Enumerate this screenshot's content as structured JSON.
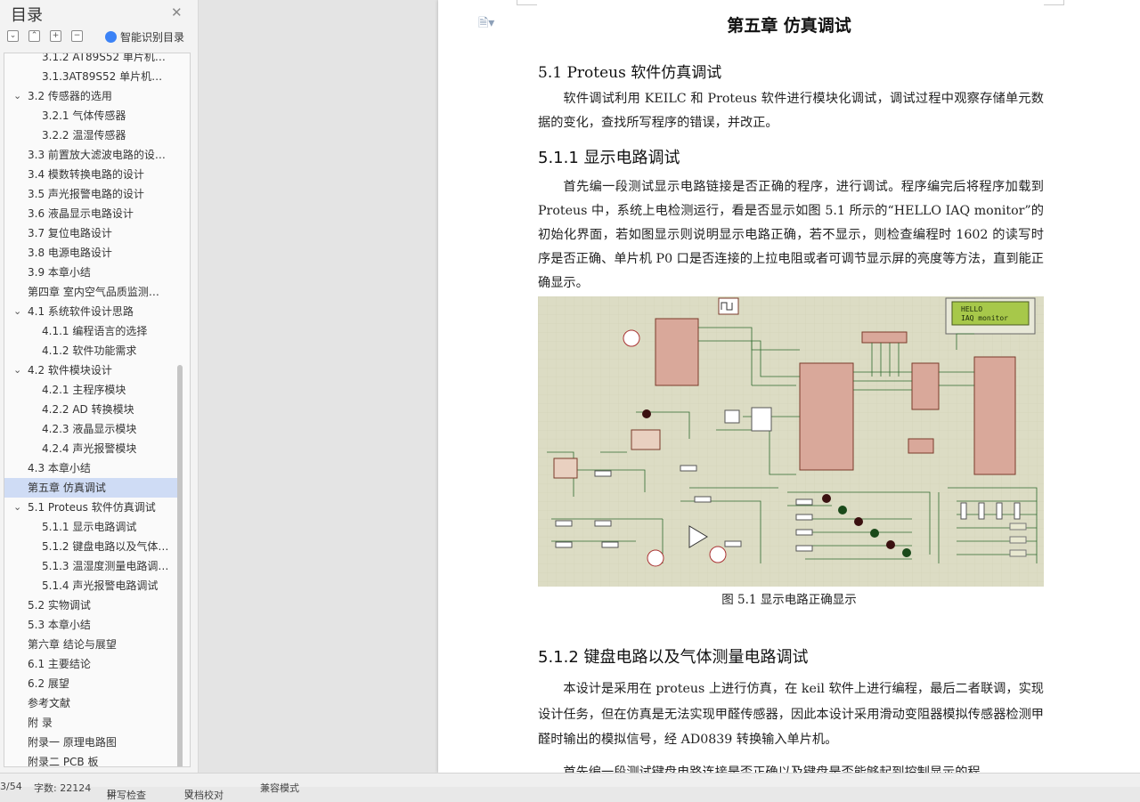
{
  "sidebar": {
    "title": "目录",
    "smart_toc_label": "智能识别目录",
    "items": [
      {
        "label": "3.1.2 AT89S52 单片机…",
        "level": 3
      },
      {
        "label": "3.1.3AT89S52 单片机…",
        "level": 3
      },
      {
        "label": "3.2 传感器的选用",
        "level": 2,
        "expanded": true
      },
      {
        "label": "3.2.1 气体传感器",
        "level": 3
      },
      {
        "label": "3.2.2 温湿传感器",
        "level": 3
      },
      {
        "label": "3.3 前置放大滤波电路的设…",
        "level": 2
      },
      {
        "label": "3.4 模数转换电路的设计",
        "level": 2
      },
      {
        "label": "3.5 声光报警电路的设计",
        "level": 2
      },
      {
        "label": "3.6 液晶显示电路设计",
        "level": 2
      },
      {
        "label": "3.7 复位电路设计",
        "level": 2
      },
      {
        "label": "3.8 电源电路设计",
        "level": 2
      },
      {
        "label": "3.9 本章小结",
        "level": 2
      },
      {
        "label": "第四章  室内空气品质监测…",
        "level": 1
      },
      {
        "label": "4.1 系统软件设计思路",
        "level": 2,
        "expanded": true
      },
      {
        "label": "4.1.1 编程语言的选择",
        "level": 3
      },
      {
        "label": "4.1.2 软件功能需求",
        "level": 3
      },
      {
        "label": "4.2 软件模块设计",
        "level": 2,
        "expanded": true
      },
      {
        "label": "4.2.1 主程序模块",
        "level": 3
      },
      {
        "label": "4.2.2 AD 转换模块",
        "level": 3
      },
      {
        "label": "4.2.3 液晶显示模块",
        "level": 3
      },
      {
        "label": "4.2.4 声光报警模块",
        "level": 3
      },
      {
        "label": "4.3 本章小结",
        "level": 2
      },
      {
        "label": "第五章  仿真调试",
        "level": 1,
        "selected": true
      },
      {
        "label": "5.1 Proteus  软件仿真调试",
        "level": 2,
        "expanded": true
      },
      {
        "label": "5.1.1 显示电路调试",
        "level": 3
      },
      {
        "label": "5.1.2 键盘电路以及气体…",
        "level": 3
      },
      {
        "label": "5.1.3 温湿度测量电路调…",
        "level": 3
      },
      {
        "label": "5.1.4 声光报警电路调试",
        "level": 3
      },
      {
        "label": "5.2  实物调试",
        "level": 2
      },
      {
        "label": "5.3 本章小结",
        "level": 2
      },
      {
        "label": "第六章    结论与展望",
        "level": 1
      },
      {
        "label": "6.1 主要结论",
        "level": 2
      },
      {
        "label": "6.2 展望",
        "level": 2
      },
      {
        "label": "参考文献",
        "level": 1
      },
      {
        "label": "附    录",
        "level": 1
      },
      {
        "label": "附录一  原理电路图",
        "level": 1
      },
      {
        "label": "附录二  PCB 板",
        "level": 1
      }
    ]
  },
  "document": {
    "chapter_title": "第五章  仿真调试",
    "section_5_1": "5.1 Proteus  软件仿真调试",
    "para_1": "软件调试利用 KEILC 和 Proteus 软件进行模块化调试，调试过程中观察存储单元数据的变化，查找所写程序的错误，并改正。",
    "section_5_1_1": "5.1.1 显示电路调试",
    "para_2": "首先编一段测试显示电路链接是否正确的程序，进行调试。程序编完后将程序加载到 Proteus 中，系统上电检测运行，看是否显示如图 5.1 所示的“HELLO IAQ monitor”的初始化界面，若如图显示则说明显示电路正确，若不显示，则检查编程时 1602 的读写时序是否正确、单片机 P0 口是否连接的上拉电阻或者可调节显示屏的亮度等方法，直到能正确显示。",
    "figure": {
      "lcd_line_1": "HELLO",
      "lcd_line_2": "IAQ monitor",
      "caption": "图 5.1  显示电路正确显示"
    },
    "section_5_1_2": "5.1.2 键盘电路以及气体测量电路调试",
    "para_3": "本设计是采用在 proteus 上进行仿真，在 keil 软件上进行编程，最后二者联调，实现设计任务，但在仿真是无法实现甲醛传感器，因此本设计采用滑动变阻器模拟传感器检测甲醛时输出的模拟信号，经 AD0839 转换输入单片机。",
    "para_4": "首先编一段测试键盘电路连接是否正确以及键盘是否能够起到控制显示的程"
  },
  "statusbar": {
    "page": "3/54",
    "word_count": "字数: 22124",
    "spell_check": "拼写检查",
    "doc_check": "文档校对",
    "mode": "兼容模式"
  },
  "colors": {
    "selected_row": "#cfdcf5",
    "figure_bg": "#dcdcc4",
    "lcd_green": "#a7c84a"
  }
}
